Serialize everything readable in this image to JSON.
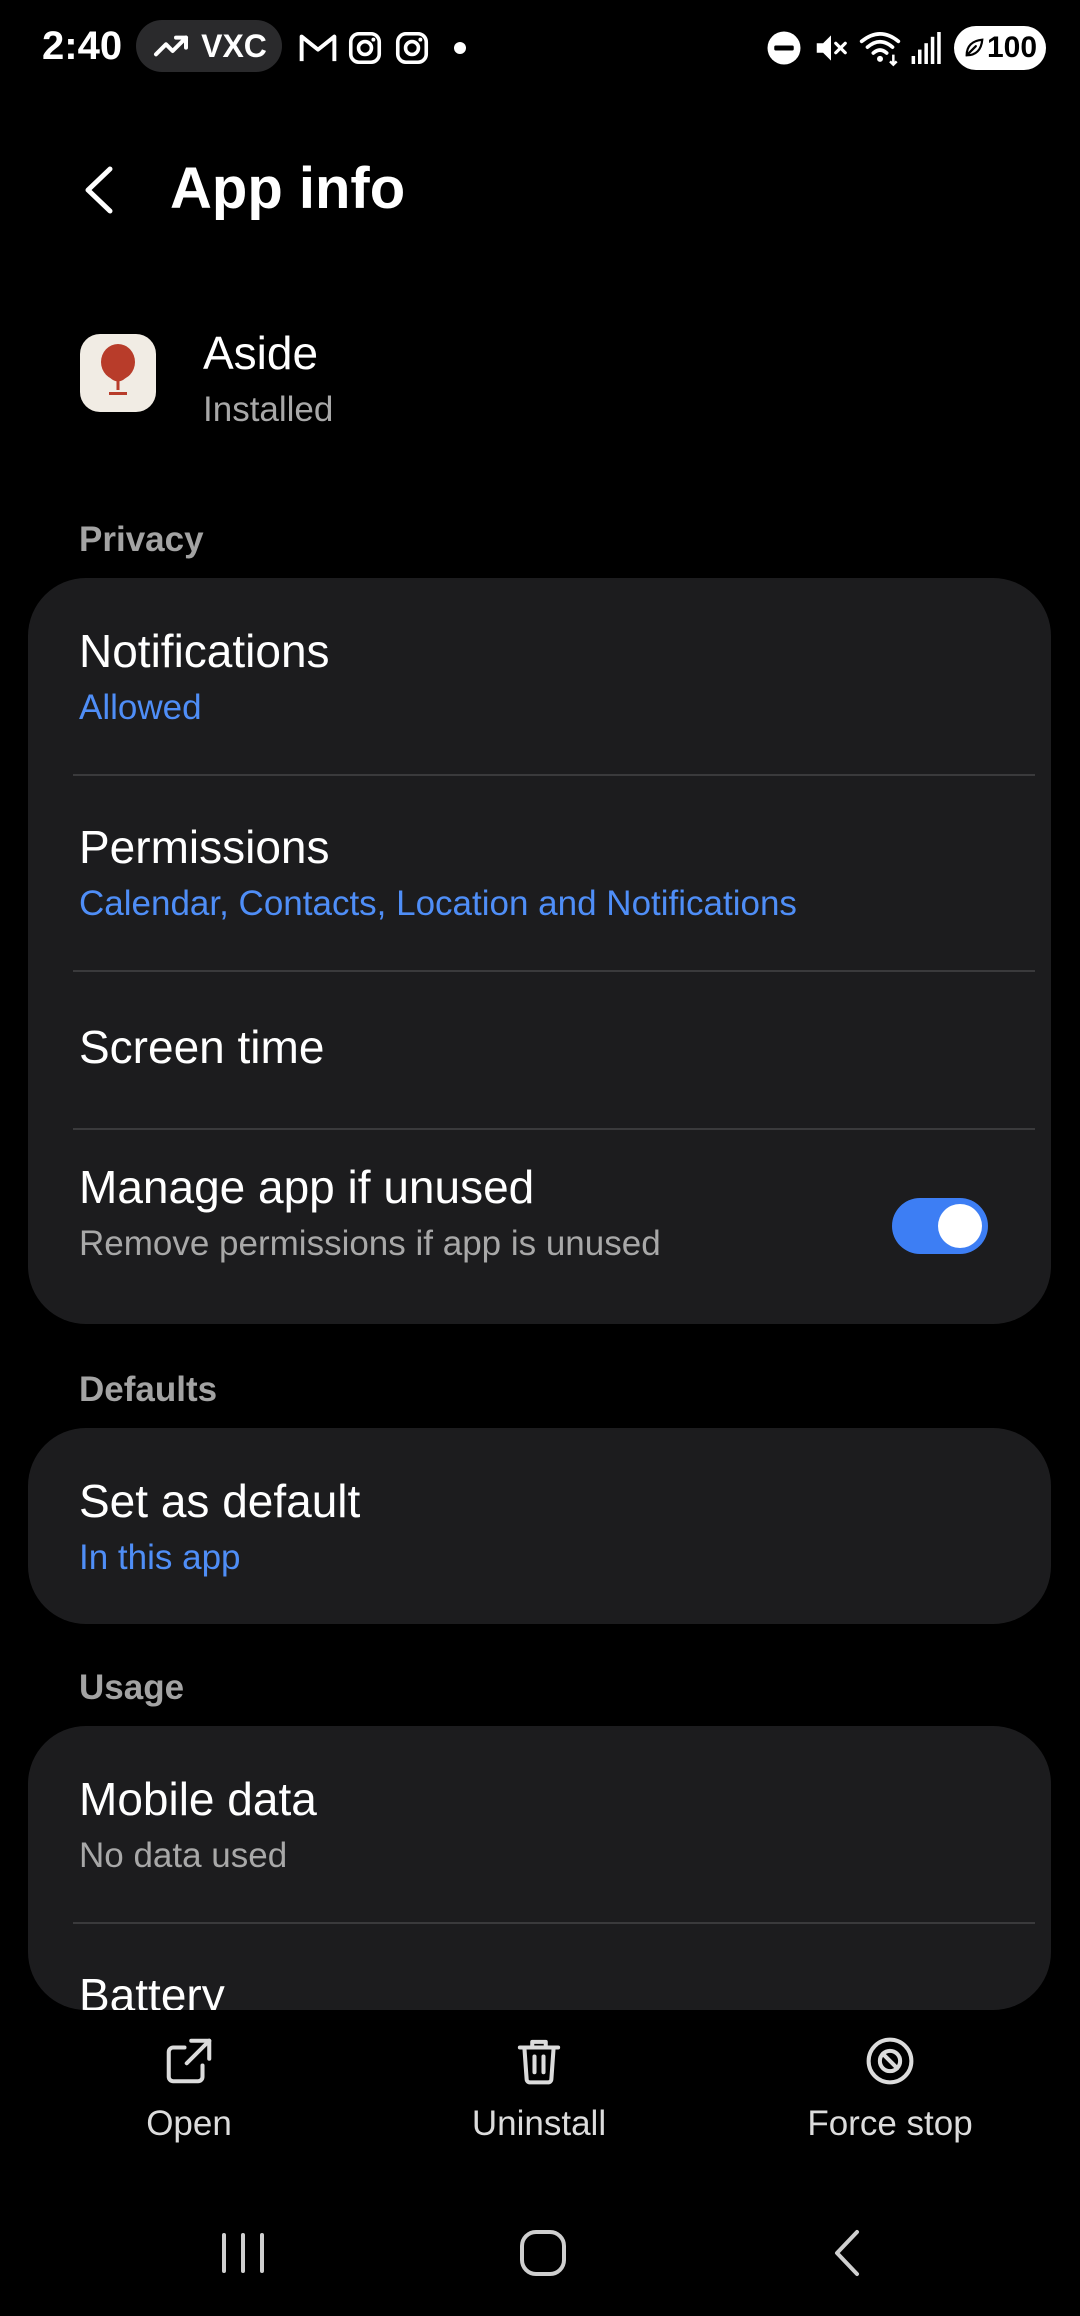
{
  "status_bar": {
    "time": "2:40",
    "ticker": "VXC",
    "battery": "100",
    "icons": [
      "trending-up-icon",
      "gmail-icon",
      "instagram-icon",
      "instagram-icon",
      "dot-icon",
      "dnd-icon",
      "mute-icon",
      "wifi-icon",
      "signal-icon",
      "battery-icon"
    ]
  },
  "header": {
    "title": "App info"
  },
  "app": {
    "name": "Aside",
    "status": "Installed"
  },
  "sections": {
    "privacy": {
      "label": "Privacy",
      "notifications": {
        "title": "Notifications",
        "value": "Allowed"
      },
      "permissions": {
        "title": "Permissions",
        "value": "Calendar, Contacts, Location and Notifications"
      },
      "screen_time": {
        "title": "Screen time"
      },
      "manage_unused": {
        "title": "Manage app if unused",
        "subtitle": "Remove permissions if app is unused",
        "enabled": true
      }
    },
    "defaults": {
      "label": "Defaults",
      "set_default": {
        "title": "Set as default",
        "value": "In this app"
      }
    },
    "usage": {
      "label": "Usage",
      "mobile_data": {
        "title": "Mobile data",
        "value": "No data used"
      },
      "battery": {
        "title": "Battery"
      }
    }
  },
  "actions": {
    "open": "Open",
    "uninstall": "Uninstall",
    "force_stop": "Force stop"
  },
  "colors": {
    "accent": "#4f8ef7",
    "toggle_on": "#3d7ef4",
    "card": "#1c1c1e",
    "background": "#000000"
  }
}
